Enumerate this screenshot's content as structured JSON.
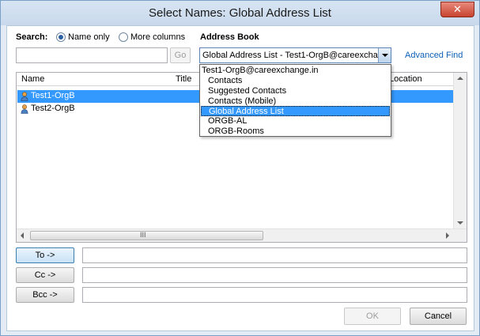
{
  "window": {
    "title": "Select Names: Global Address List",
    "close_glyph": "✕"
  },
  "search": {
    "label": "Search:",
    "radio_name_only": "Name only",
    "radio_more_columns": "More columns",
    "selected_option": "Name only",
    "input_value": "",
    "go_label": "Go"
  },
  "address_book": {
    "label": "Address Book",
    "selected_value": "Global Address List - Test1-OrgB@careexchar",
    "advanced_find": "Advanced Find",
    "dropdown_items": [
      "Test1-OrgB@careexchange.in",
      "Contacts",
      "Suggested Contacts",
      "Contacts (Mobile)",
      "Global Address List",
      "ORGB-AL",
      "ORGB-Rooms"
    ],
    "dropdown_selected_index": 4
  },
  "list": {
    "columns": [
      "Name",
      "Title",
      "Location"
    ],
    "rows": [
      {
        "name": "Test1-OrgB",
        "selected": true
      },
      {
        "name": "Test2-OrgB",
        "selected": false
      }
    ],
    "hscroll_grip": "III"
  },
  "recipients": {
    "to_label": "To ->",
    "cc_label": "Cc ->",
    "bcc_label": "Bcc ->",
    "to_value": "",
    "cc_value": "",
    "bcc_value": ""
  },
  "footer": {
    "ok_label": "OK",
    "cancel_label": "Cancel"
  },
  "colors": {
    "selection": "#3399ff",
    "link": "#0d5fb8",
    "title_bar": "#c9d9ec",
    "close_button": "#c7432f"
  }
}
